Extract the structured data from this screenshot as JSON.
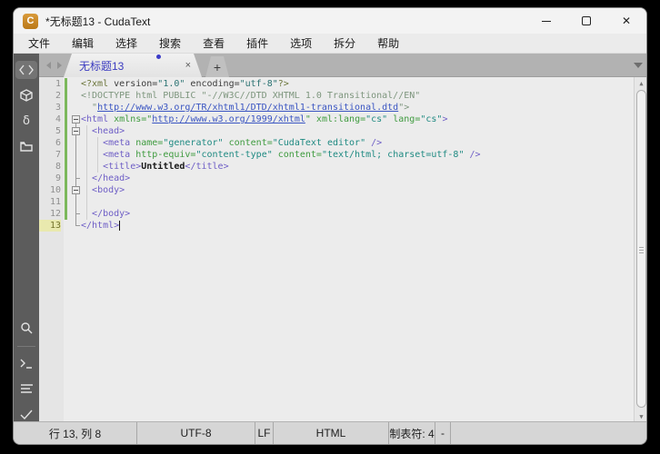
{
  "window": {
    "title": "*无标题13 - CudaText",
    "app_icon_letter": "C",
    "controls": [
      "minimize",
      "maximize",
      "close"
    ],
    "close_glyph": "✕"
  },
  "menu": {
    "items": [
      "文件",
      "编辑",
      "选择",
      "搜索",
      "查看",
      "插件",
      "选项",
      "拆分",
      "帮助"
    ]
  },
  "tabbar": {
    "active_tab": "无标题13",
    "close_glyph": "×",
    "new_tab_glyph": "+",
    "modified_dot_color": "#3c3cc8"
  },
  "sidebar": {
    "icons": [
      "code",
      "cube",
      "delta",
      "folder",
      "search",
      "terminal",
      "list",
      "check"
    ],
    "delta_glyph": "δ"
  },
  "editor": {
    "language": "HTML",
    "caret": {
      "line": 13,
      "column": 8
    },
    "lines": [
      {
        "n": 1,
        "changed": true,
        "t": [
          [
            "pi",
            "<?xml"
          ],
          [
            "pl",
            " version="
          ],
          [
            "pv",
            "\"1.0\""
          ],
          [
            "pl",
            " encoding="
          ],
          [
            "pv",
            "\"utf-8\""
          ],
          [
            "pi",
            "?>"
          ]
        ]
      },
      {
        "n": 2,
        "changed": true,
        "t": [
          [
            "dt",
            "<!DOCTYPE html PUBLIC \"-//W3C//DTD XHTML 1.0 Transitional//EN\""
          ]
        ]
      },
      {
        "n": 3,
        "changed": true,
        "t": [
          [
            "dt",
            "  \""
          ],
          [
            "url",
            "http://www.w3.org/TR/xhtml1/DTD/xhtml1-transitional.dtd"
          ],
          [
            "dt",
            "\">"
          ]
        ]
      },
      {
        "n": 4,
        "changed": true,
        "t": [
          [
            "tag",
            "<html"
          ],
          [
            "at",
            " xmlns="
          ],
          [
            "at",
            "\""
          ],
          [
            "url",
            "http://www.w3.org/1999/xhtml"
          ],
          [
            "at",
            "\""
          ],
          [
            "at",
            " xml:lang="
          ],
          [
            "vl",
            "\"cs\""
          ],
          [
            "at",
            " lang="
          ],
          [
            "vl",
            "\"cs\""
          ],
          [
            "tag",
            ">"
          ]
        ]
      },
      {
        "n": 5,
        "changed": true,
        "t": [
          [
            "pl",
            "  "
          ],
          [
            "tag",
            "<head>"
          ]
        ]
      },
      {
        "n": 6,
        "changed": true,
        "t": [
          [
            "pl",
            "    "
          ],
          [
            "tag",
            "<meta"
          ],
          [
            "at",
            " name="
          ],
          [
            "vl",
            "\"generator\""
          ],
          [
            "at",
            " content="
          ],
          [
            "vl",
            "\"CudaText editor\""
          ],
          [
            "tag",
            " />"
          ]
        ]
      },
      {
        "n": 7,
        "changed": true,
        "t": [
          [
            "pl",
            "    "
          ],
          [
            "tag",
            "<meta"
          ],
          [
            "at",
            " http-equiv="
          ],
          [
            "vl",
            "\"content-type\""
          ],
          [
            "at",
            " content="
          ],
          [
            "vl",
            "\"text/html; charset=utf-8\""
          ],
          [
            "tag",
            " />"
          ]
        ]
      },
      {
        "n": 8,
        "changed": true,
        "t": [
          [
            "pl",
            "    "
          ],
          [
            "tag",
            "<title>"
          ],
          [
            "tx",
            "Untitled"
          ],
          [
            "tag",
            "</title>"
          ]
        ]
      },
      {
        "n": 9,
        "changed": true,
        "t": [
          [
            "pl",
            "  "
          ],
          [
            "tag",
            "</head>"
          ]
        ]
      },
      {
        "n": 10,
        "changed": true,
        "t": [
          [
            "pl",
            "  "
          ],
          [
            "tag",
            "<body>"
          ]
        ]
      },
      {
        "n": 11,
        "changed": true,
        "t": []
      },
      {
        "n": 12,
        "changed": true,
        "t": [
          [
            "pl",
            "  "
          ],
          [
            "tag",
            "</body>"
          ]
        ]
      },
      {
        "n": 13,
        "changed": false,
        "current": true,
        "t": [
          [
            "tag",
            "</html>"
          ]
        ]
      }
    ]
  },
  "statusbar": {
    "cells": [
      "行 13, 列 8",
      "UTF-8",
      "LF",
      "HTML",
      "制表符: 4",
      "-"
    ]
  },
  "colors": {
    "tag": "#6e5ec6",
    "attribute": "#3f9b3f",
    "value": "#1f8a82",
    "url": "#3a55c2",
    "doctype": "#7e967e",
    "processing_instruction": "#6b753a",
    "changed_line_bar": "#7cb85c",
    "current_line_gutter": "#e9e9ae",
    "tab_text": "#3b3bc0",
    "sidebar_bg": "#5c5c5c",
    "app_icon": "#c98a28"
  }
}
